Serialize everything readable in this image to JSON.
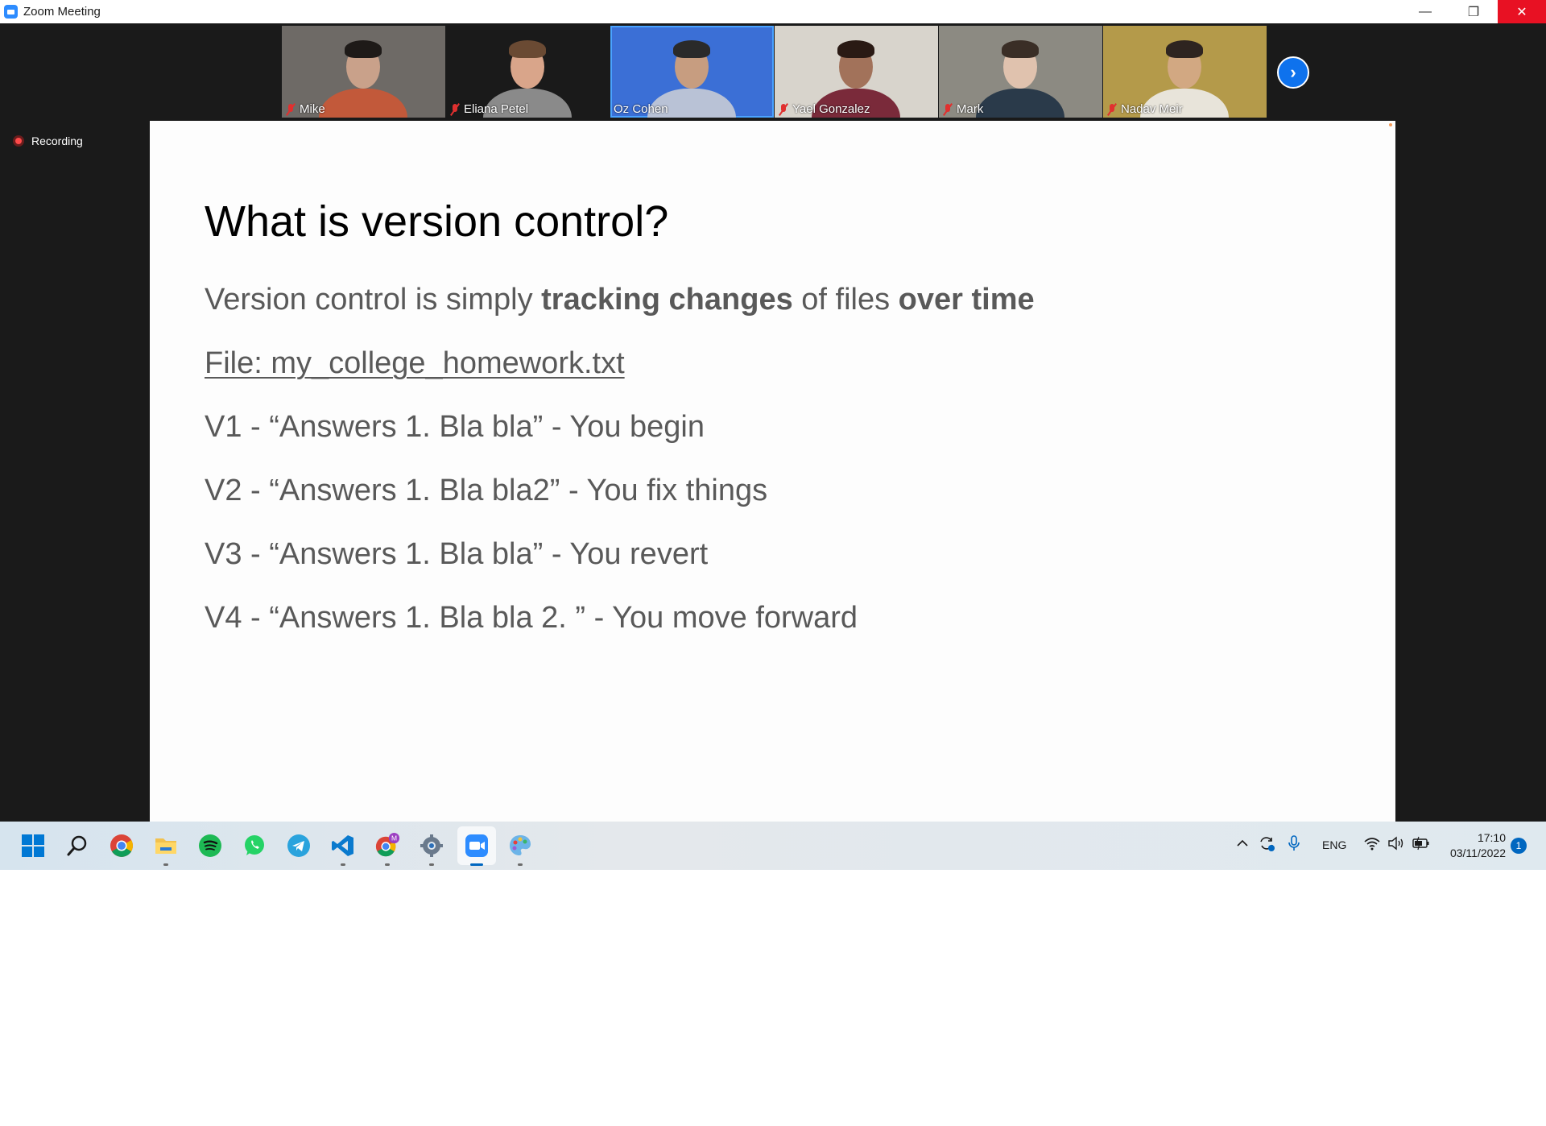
{
  "window": {
    "title": "Zoom Meeting",
    "minimize": "—",
    "restore": "❐",
    "close": "✕"
  },
  "participants": [
    {
      "name": "Mike",
      "muted": true,
      "bg": "#6e6a66",
      "skin": "#c9a18a",
      "hair": "#1e1a18",
      "shirt": "#c2593a"
    },
    {
      "name": "Eliana Petel",
      "muted": true,
      "bg": "#1a1a1a",
      "skin": "#d9a58a",
      "hair": "#6a4a33",
      "shirt": "#8a8a8a"
    },
    {
      "name": "Oz Cohen",
      "muted": false,
      "bg": "#3b6fd6",
      "skin": "#c79d80",
      "hair": "#2a2a2a",
      "shirt": "#b9c2d6"
    },
    {
      "name": "Yael Gonzalez",
      "muted": true,
      "bg": "#d8d4cc",
      "skin": "#a2725a",
      "hair": "#2a1a14",
      "shirt": "#7a2a3a"
    },
    {
      "name": "Mark",
      "muted": true,
      "bg": "#8c8a82",
      "skin": "#e0c2ae",
      "hair": "#3a2e26",
      "shirt": "#2a3a4a"
    },
    {
      "name": "Nadav Meir",
      "muted": true,
      "bg": "#b49a4a",
      "skin": "#d2a882",
      "hair": "#2e2420",
      "shirt": "#e8e4da"
    }
  ],
  "next_button": "›",
  "recording": {
    "label": "Recording"
  },
  "slide": {
    "title": "What is version control?",
    "intro": {
      "part1": "Version control is simply ",
      "bold1": "tracking changes",
      "part2": " of files ",
      "bold2": "over time"
    },
    "file": "File: my_college_homework.txt",
    "versions": [
      "V1 - “Answers 1. Bla bla” - You begin",
      "V2 - “Answers 1. Bla bla2” - You fix things",
      "V3 - “Answers 1. Bla bla” - You revert",
      "V4 - “Answers 1. Bla bla 2. ” - You move forward"
    ]
  },
  "taskbar": {
    "apps": [
      "windows-start-icon",
      "search-icon",
      "chrome-icon",
      "file-explorer-icon",
      "spotify-icon",
      "whatsapp-icon",
      "telegram-icon",
      "vscode-icon",
      "chrome-profile-icon",
      "settings-icon",
      "zoom-icon",
      "paint-icon"
    ],
    "tray": {
      "language": "ENG",
      "time": "17:10",
      "date": "03/11/2022",
      "notifications": "1"
    }
  }
}
